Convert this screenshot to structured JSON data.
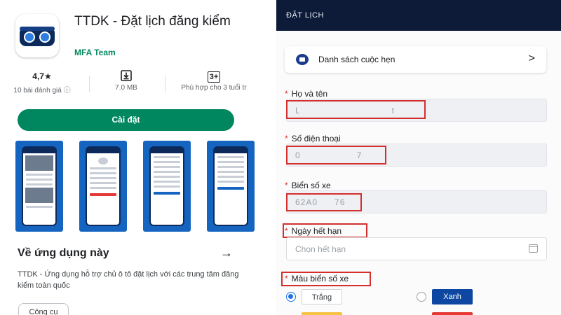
{
  "store": {
    "app_title": "TTDK - Đặt lịch đăng kiểm",
    "developer": "MFA Team",
    "stats": [
      {
        "value": "4,7★",
        "label": "10 bài đánh giá ⓘ"
      },
      {
        "value": "",
        "label": "7.0 MB",
        "icon": "download-icon"
      },
      {
        "value": "3+",
        "label": "Phù hợp cho 3 tuổi tr",
        "icon": "rating-3plus-icon"
      }
    ],
    "install_label": "Cài đặt",
    "about_heading": "Về ứng dụng này",
    "about_arrow": "→",
    "description": "TTDK - Ứng dụng hỗ trợ chủ ô tô đặt lịch với các trung tâm đăng kiểm toàn quốc",
    "category_chip": "Công cụ"
  },
  "form": {
    "header_title": "ĐẶT LỊCH",
    "appointments_label": "Danh sách cuộc hẹn",
    "chevron": ">",
    "required_mark": "*",
    "fields": {
      "name": {
        "label": "Họ và tên",
        "value_start": "L",
        "value_end": "t"
      },
      "phone": {
        "label": "Số điện thoại",
        "value_start": "0",
        "value_end": "7"
      },
      "plate": {
        "label": "Biển số xe",
        "value_start": "62A0",
        "value_end": "76"
      },
      "expiry": {
        "label": "Ngày hết hạn",
        "placeholder": "Chọn hết hạn"
      },
      "plate_color": {
        "label": "Màu biển số xe"
      }
    },
    "color_options": [
      {
        "label": "Trắng",
        "selected": true,
        "color": "#ffffff"
      },
      {
        "label": "Xanh",
        "selected": false,
        "color": "#0d47a1"
      }
    ],
    "extra_colors": [
      "#f6c343",
      "#e53935"
    ],
    "highlight_color": "#d32f2f",
    "accent_color": "#01875f",
    "header_color": "#0d1b38"
  }
}
